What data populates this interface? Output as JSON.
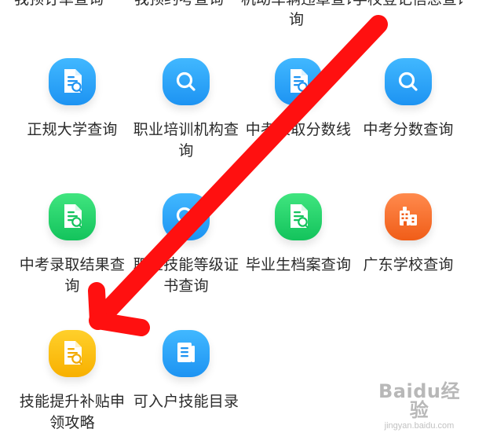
{
  "top_row": {
    "cells": [
      "我预订单查询",
      "我预约考查询",
      "机动车辆违章查询",
      "学校登记信息查询"
    ],
    "overflow_line": "询"
  },
  "items": [
    {
      "label_line1": "正规大学查询",
      "label_line2": "",
      "icon": "document-search-icon",
      "color": "#2aa6ff"
    },
    {
      "label_line1": "职业培训机构查",
      "label_line2": "询",
      "icon": "search-icon",
      "color": "#2aa6ff"
    },
    {
      "label_line1": "中考录取分数线",
      "label_line2": "",
      "icon": "document-search-icon",
      "color": "#2aa6ff"
    },
    {
      "label_line1": "中考分数查询",
      "label_line2": "",
      "icon": "search-icon",
      "color": "#2aa6ff"
    },
    {
      "label_line1": "中考录取结果查",
      "label_line2": "询",
      "icon": "document-search-icon",
      "color": "#21d267"
    },
    {
      "label_line1": "职业技能等级证",
      "label_line2": "书查询",
      "icon": "search-icon",
      "color": "#2aa6ff"
    },
    {
      "label_line1": "毕业生档案查询",
      "label_line2": "",
      "icon": "document-search-icon",
      "color": "#21d267"
    },
    {
      "label_line1": "广东学校查询",
      "label_line2": "",
      "icon": "building-icon",
      "color": "#ff6f2e"
    },
    {
      "label_line1": "技能提升补贴申",
      "label_line2": "领攻略",
      "icon": "document-search-icon",
      "color": "#ffbf00"
    },
    {
      "label_line1": "可入户技能目录",
      "label_line2": "",
      "icon": "notebook-icon",
      "color": "#2aa6ff"
    }
  ],
  "annotation": {
    "arrow_color": "#ff1010",
    "target": "技能提升补贴申领攻略"
  },
  "watermark": {
    "brand": "Baidu经验",
    "domain": "jingyan.baidu.com"
  }
}
